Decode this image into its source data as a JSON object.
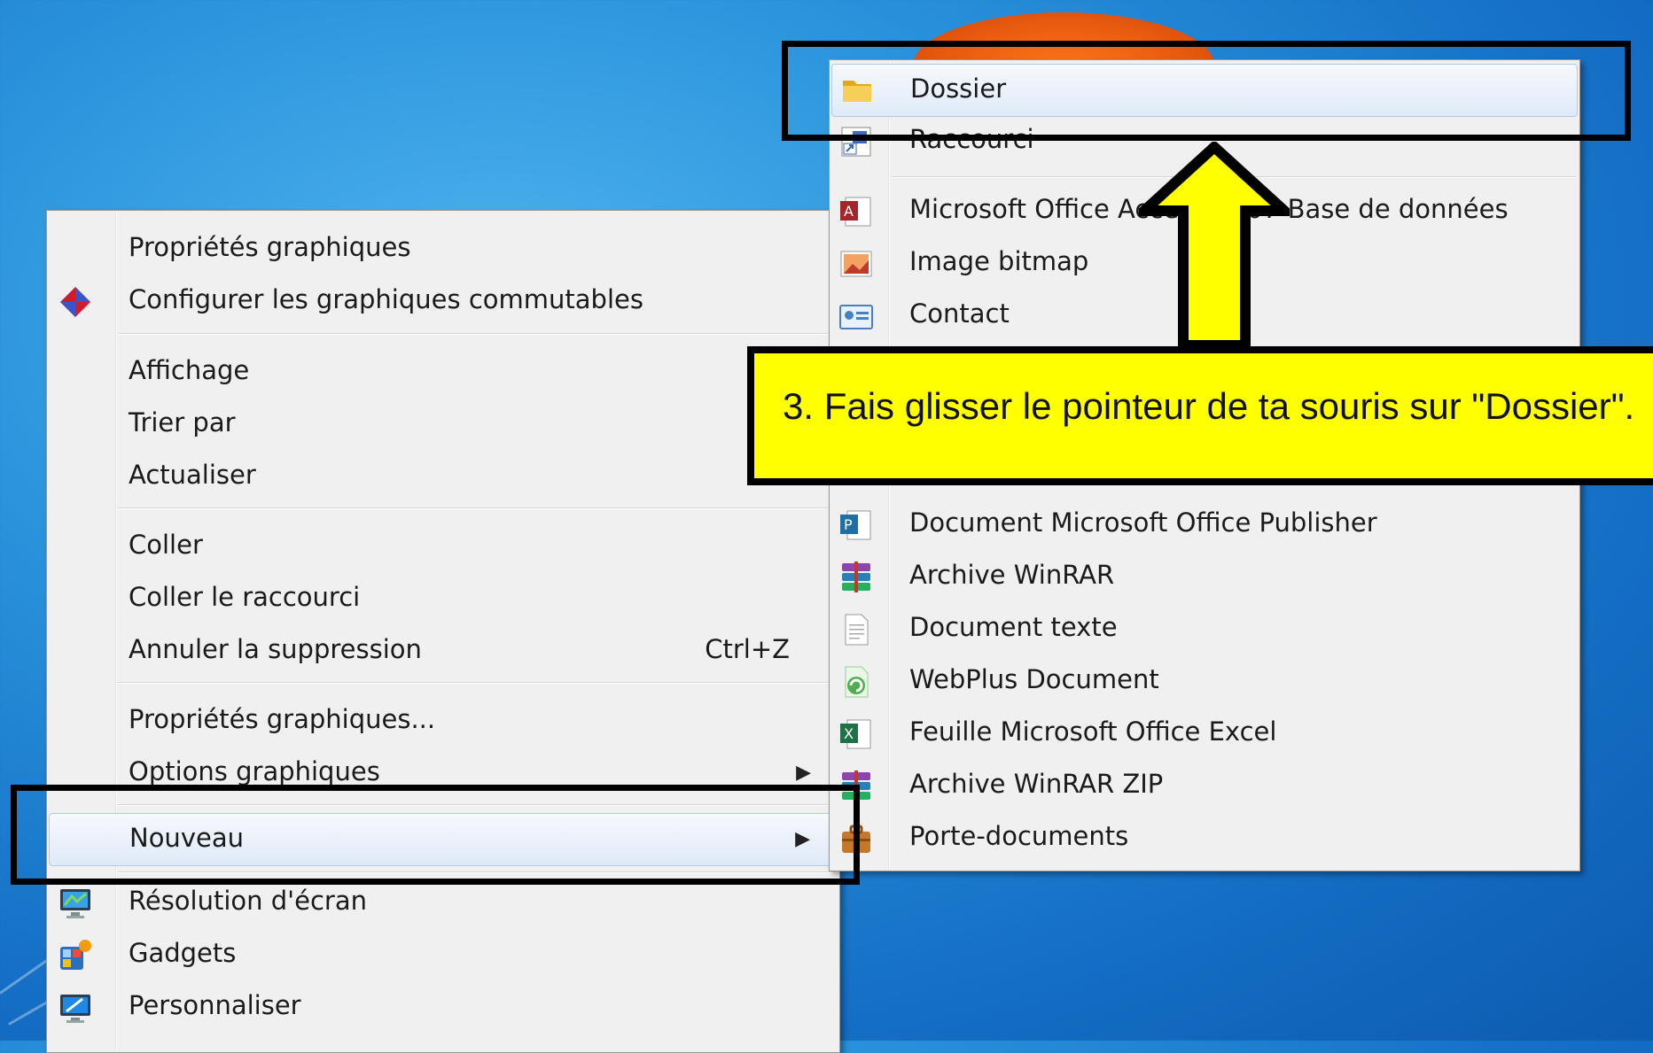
{
  "main_menu": {
    "items": [
      {
        "label": "Propriétés graphiques"
      },
      {
        "label": "Configurer les graphiques commutables",
        "icon": "switchable-graphics-icon"
      },
      {
        "label": "Affichage"
      },
      {
        "label": "Trier par"
      },
      {
        "label": "Actualiser"
      },
      {
        "label": "Coller"
      },
      {
        "label": "Coller le raccourci"
      },
      {
        "label": "Annuler la suppression",
        "shortcut": "Ctrl+Z"
      },
      {
        "label": "Propriétés graphiques..."
      },
      {
        "label": "Options graphiques",
        "submenu": true
      },
      {
        "label": "Nouveau",
        "submenu": true,
        "highlighted": true
      },
      {
        "label": "Résolution d'écran",
        "icon": "screen-resolution-icon"
      },
      {
        "label": "Gadgets",
        "icon": "gadgets-icon"
      },
      {
        "label": "Personnaliser",
        "icon": "personalize-icon"
      }
    ]
  },
  "sub_menu": {
    "items": [
      {
        "label": "Dossier",
        "icon": "folder-icon",
        "highlighted": true
      },
      {
        "label": "Raccourci",
        "icon": "shortcut-icon"
      },
      {
        "label": "Microsoft Office Access 2007 Base de données",
        "icon": "access-icon"
      },
      {
        "label": "Image bitmap",
        "icon": "bitmap-icon"
      },
      {
        "label": "Contact",
        "icon": "contact-icon"
      },
      {
        "label": "Document Microsoft Office Publisher",
        "icon": "publisher-icon"
      },
      {
        "label": "Archive WinRAR",
        "icon": "winrar-icon"
      },
      {
        "label": "Document texte",
        "icon": "text-document-icon"
      },
      {
        "label": "WebPlus Document",
        "icon": "webplus-icon"
      },
      {
        "label": "Feuille Microsoft Office Excel",
        "icon": "excel-icon"
      },
      {
        "label": "Archive WinRAR ZIP",
        "icon": "winrar-zip-icon"
      },
      {
        "label": "Porte-documents",
        "icon": "briefcase-icon"
      }
    ]
  },
  "annotation": {
    "callout_text": "3. Fais glisser le pointeur de ta souris sur \"Dossier\".",
    "callout_color": "#ffff00",
    "arrow_direction": "up"
  },
  "colors": {
    "desktop": "#2a93dc",
    "menu_bg": "#f0f0f0",
    "highlight_border": "#aecbec"
  }
}
